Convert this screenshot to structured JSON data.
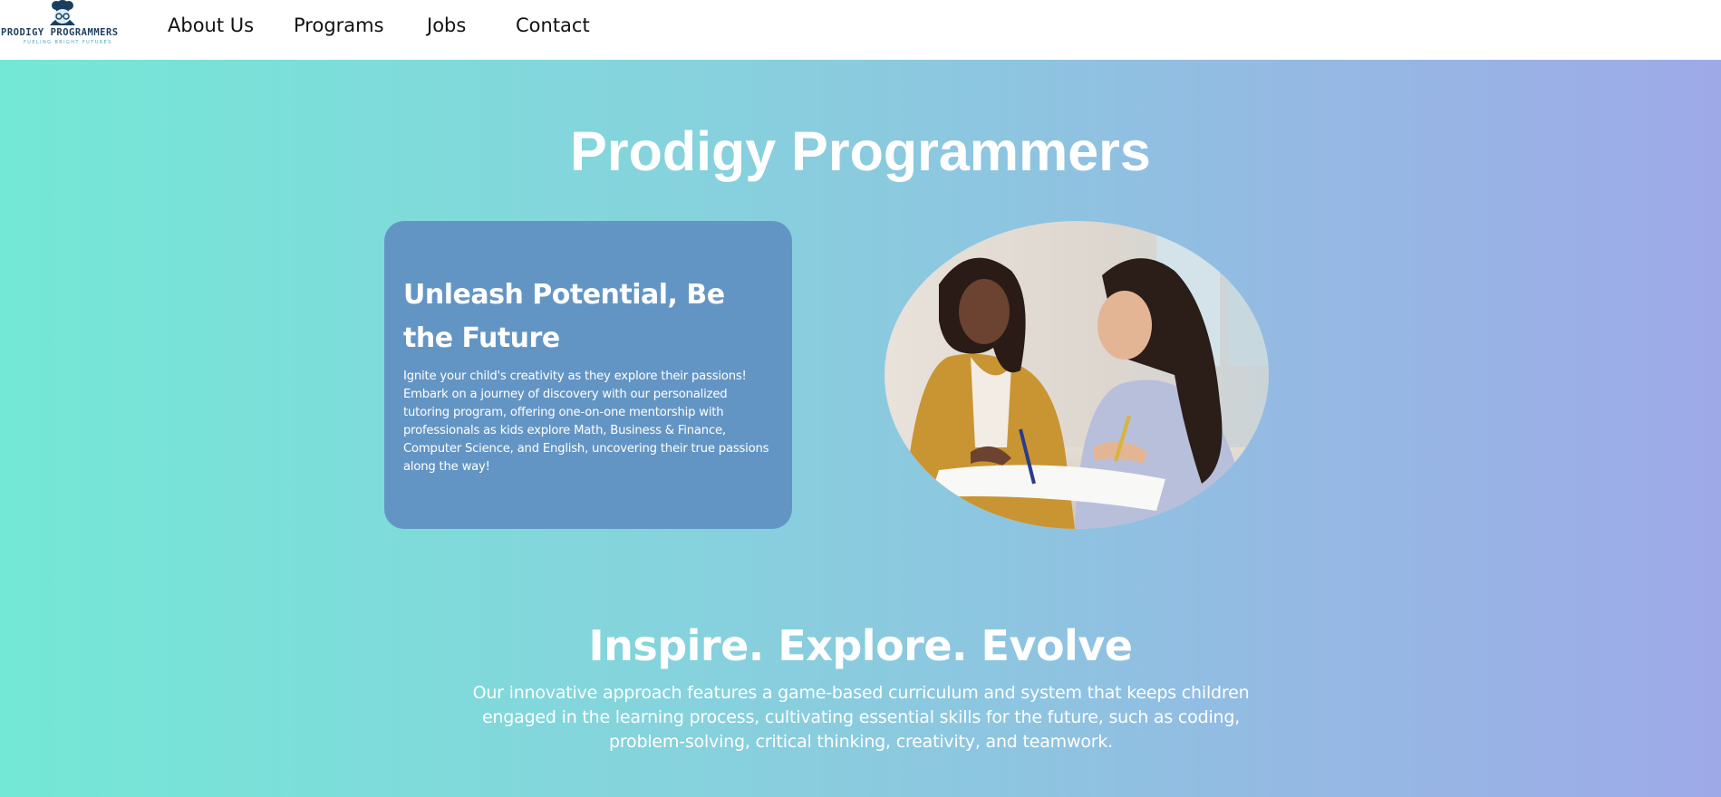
{
  "nav": {
    "logo": {
      "name": "PRODIGY PROGRAMMERS",
      "tagline": "FUELING BRIGHT FUTURES",
      "brand_color": "#1d3f5e",
      "accent_color": "#4aa3c8"
    },
    "links": [
      "About Us",
      "Programs",
      "Jobs",
      "Contact"
    ]
  },
  "hero": {
    "title": "Prodigy Programmers",
    "gradient_start": "#74e8d6",
    "gradient_end": "#9eaae8",
    "card": {
      "title": "Unleash Potential, Be the Future",
      "body": "Ignite your child's creativity as they explore their passions! Embark on a journey of discovery with our personalized tutoring program, offering one-on-one mentorship with professionals as kids explore Math, Business & Finance, Computer Science, and English, uncovering their true passions along the way!",
      "background": "#6395c4"
    },
    "photo_icon": "tutoring-photo"
  },
  "section": {
    "title": "Inspire. Explore. Evolve",
    "body": "Our innovative approach features a game-based curriculum and system that keeps children engaged in the learning process, cultivating essential skills for the future, such as coding, problem-solving, critical thinking, creativity, and teamwork."
  }
}
